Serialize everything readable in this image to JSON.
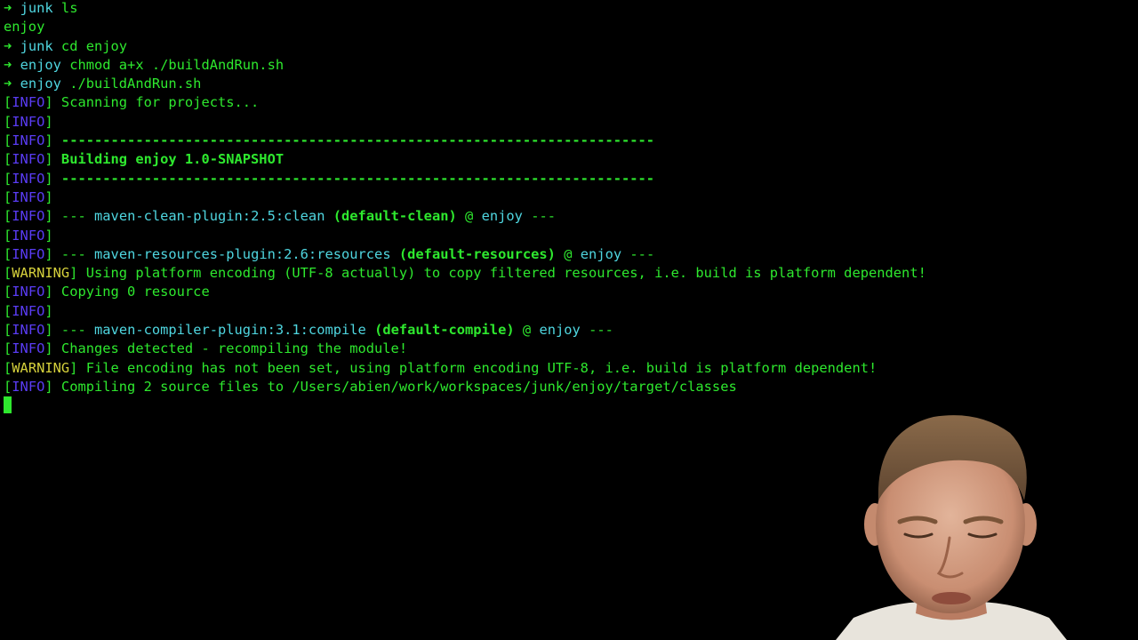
{
  "theme": {
    "background": "#000000",
    "prompt_arrow": "#2ee82e",
    "directory": "#4fd6e0",
    "command_text": "#2ee82e",
    "info_tag": "#5a3cf5",
    "warning_tag": "#d6d13c",
    "cursor": "#2ee82e"
  },
  "prompt_symbol": "➜",
  "session": {
    "ls_dir": "junk",
    "ls_cmd": "ls",
    "ls_output": "enjoy",
    "cd_dir": "junk",
    "cd_cmd": "cd enjoy",
    "chmod_dir": "enjoy",
    "chmod_cmd": "chmod a+x ./buildAndRun.sh",
    "run_dir": "enjoy",
    "run_cmd": "./buildAndRun.sh"
  },
  "log": {
    "info_tag": "INFO",
    "warning_tag": "WARNING",
    "scanning": "Scanning for projects...",
    "separator": "------------------------------------------------------------------------",
    "building": "Building enjoy 1.0-SNAPSHOT",
    "clean_plugin": "maven-clean-plugin:2.5:clean",
    "clean_goal": "(default-clean)",
    "resources_plugin": "maven-resources-plugin:2.6:resources",
    "resources_goal": "(default-resources)",
    "compiler_plugin": "maven-compiler-plugin:3.1:compile",
    "compiler_goal": "(default-compile)",
    "project": "enjoy",
    "plugin_dashes": "---",
    "at_sign": "@",
    "warning_encoding": "Using platform encoding (UTF-8 actually) to copy filtered resources, i.e. build is platform dependent!",
    "copying": "Copying 0 resource",
    "changes": "Changes detected - recompiling the module!",
    "warning_file_encoding": "File encoding has not been set, using platform encoding UTF-8, i.e. build is platform dependent!",
    "compiling": "Compiling 2 source files to /Users/abien/work/workspaces/junk/enjoy/target/classes"
  }
}
